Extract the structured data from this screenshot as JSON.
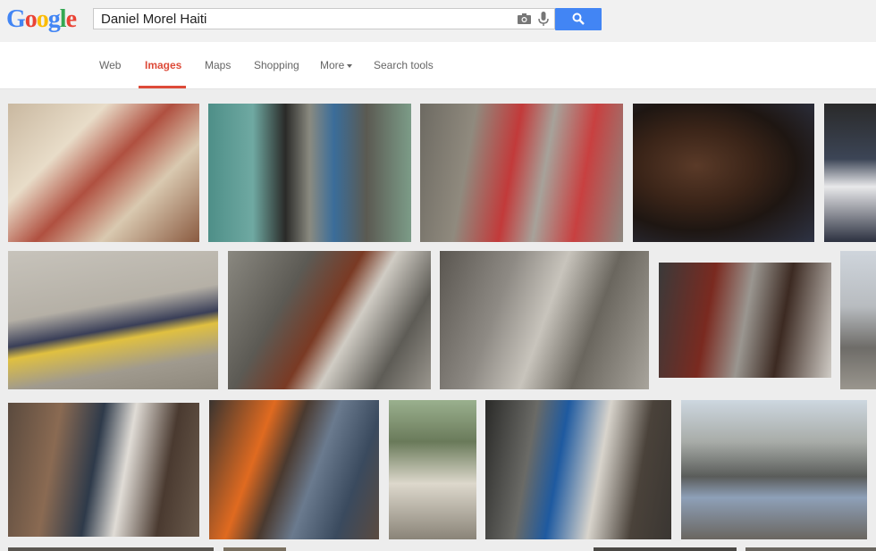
{
  "logo": {
    "letters": [
      "G",
      "o",
      "o",
      "g",
      "l",
      "e"
    ],
    "colors": [
      "#4285f4",
      "#ea4335",
      "#fbbc05",
      "#4285f4",
      "#34a853",
      "#ea4335"
    ]
  },
  "search": {
    "query": "Daniel Morel Haiti",
    "camera_icon": "camera-icon",
    "mic_icon": "microphone-icon",
    "button_icon": "search-icon",
    "button_color": "#4285f4"
  },
  "tabs": [
    "Web",
    "Images",
    "Maps",
    "Shopping",
    "More",
    "Search tools"
  ],
  "active_tab": "Images",
  "accent": "#dd4b39"
}
